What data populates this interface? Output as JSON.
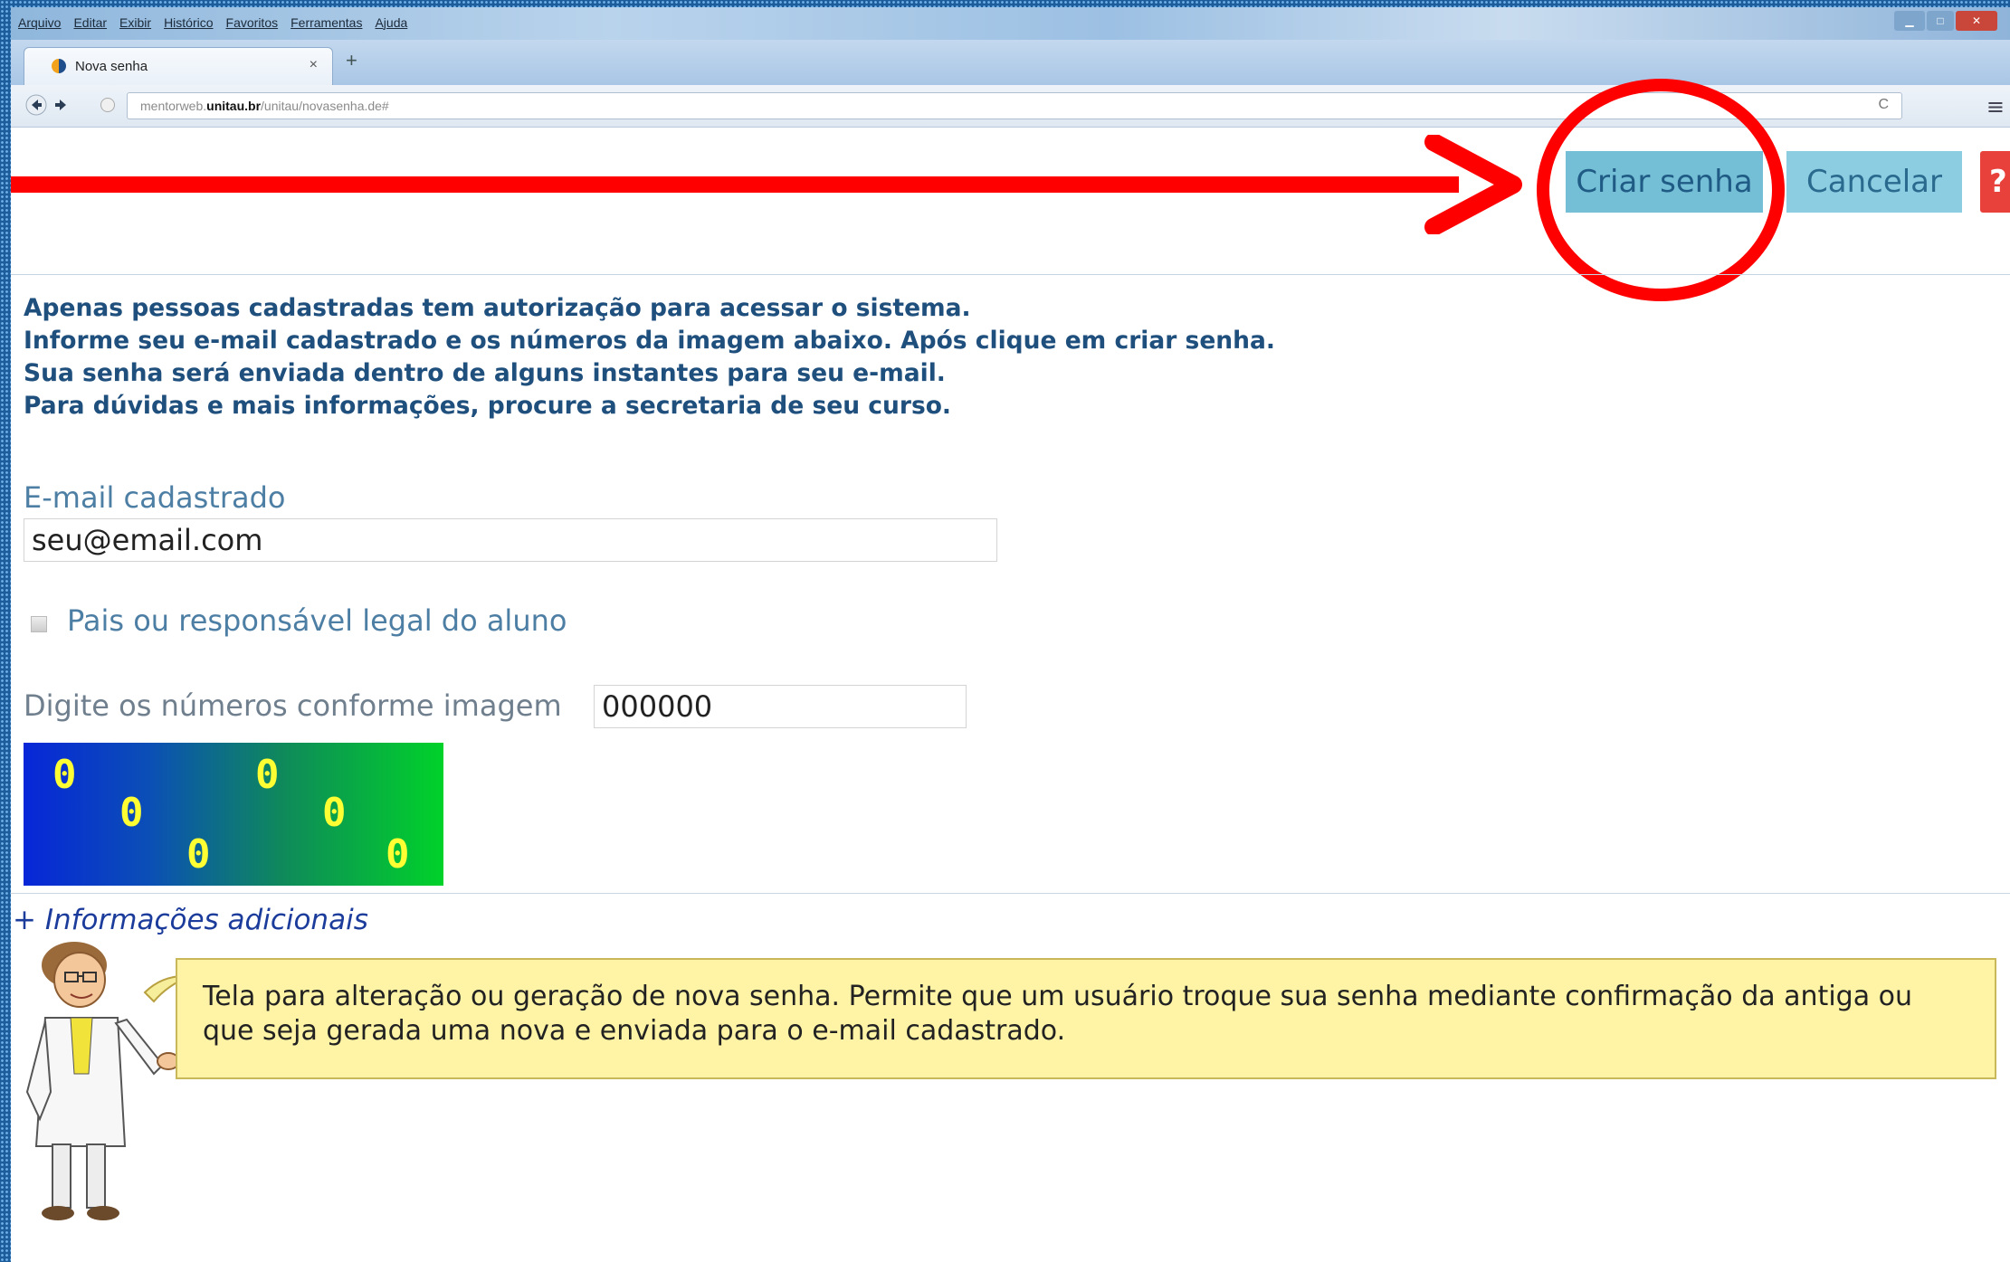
{
  "browser": {
    "menu": [
      "Arquivo",
      "Editar",
      "Exibir",
      "Histórico",
      "Favoritos",
      "Ferramentas",
      "Ajuda"
    ],
    "tab_title": "Nova senha",
    "tab_close": "×",
    "new_tab": "+",
    "url_prefix": "mentorweb.",
    "url_domain": "unitau.br",
    "url_path": "/unitau/novasenha.de#",
    "reload": "C",
    "menu_icon": "≡"
  },
  "toolbar": {
    "create_label": "Criar senha",
    "cancel_label": "Cancelar",
    "help_label": "?"
  },
  "instructions": [
    "Apenas pessoas cadastradas tem autorização para acessar o sistema.",
    "Informe seu e-mail cadastrado e os números da imagem abaixo. Após clique em criar senha.",
    "Sua senha será enviada dentro de alguns instantes para seu e-mail.",
    "Para dúvidas e mais informações, procure a secretaria de seu curso."
  ],
  "form": {
    "email_label": "E-mail cadastrado",
    "email_value": "seu@email.com",
    "guardian_label": "Pais ou responsável legal do aluno",
    "captcha_label": "Digite os números conforme imagem",
    "captcha_value": "000000",
    "captcha_digits": [
      "0",
      "0",
      "0",
      "0",
      "0",
      "0"
    ]
  },
  "more_info": "+ Informações adicionais",
  "tip_text": "Tela para alteração ou geração de nova senha. Permite que um usuário troque sua senha mediante confirmação da antiga ou que seja gerada uma nova e enviada para o e-mail cadastrado.",
  "colors": {
    "annotation": "#ff0000",
    "button": "#74bfd6",
    "instruction_text": "#1f4f7d",
    "tip_background": "#fff3a6"
  }
}
